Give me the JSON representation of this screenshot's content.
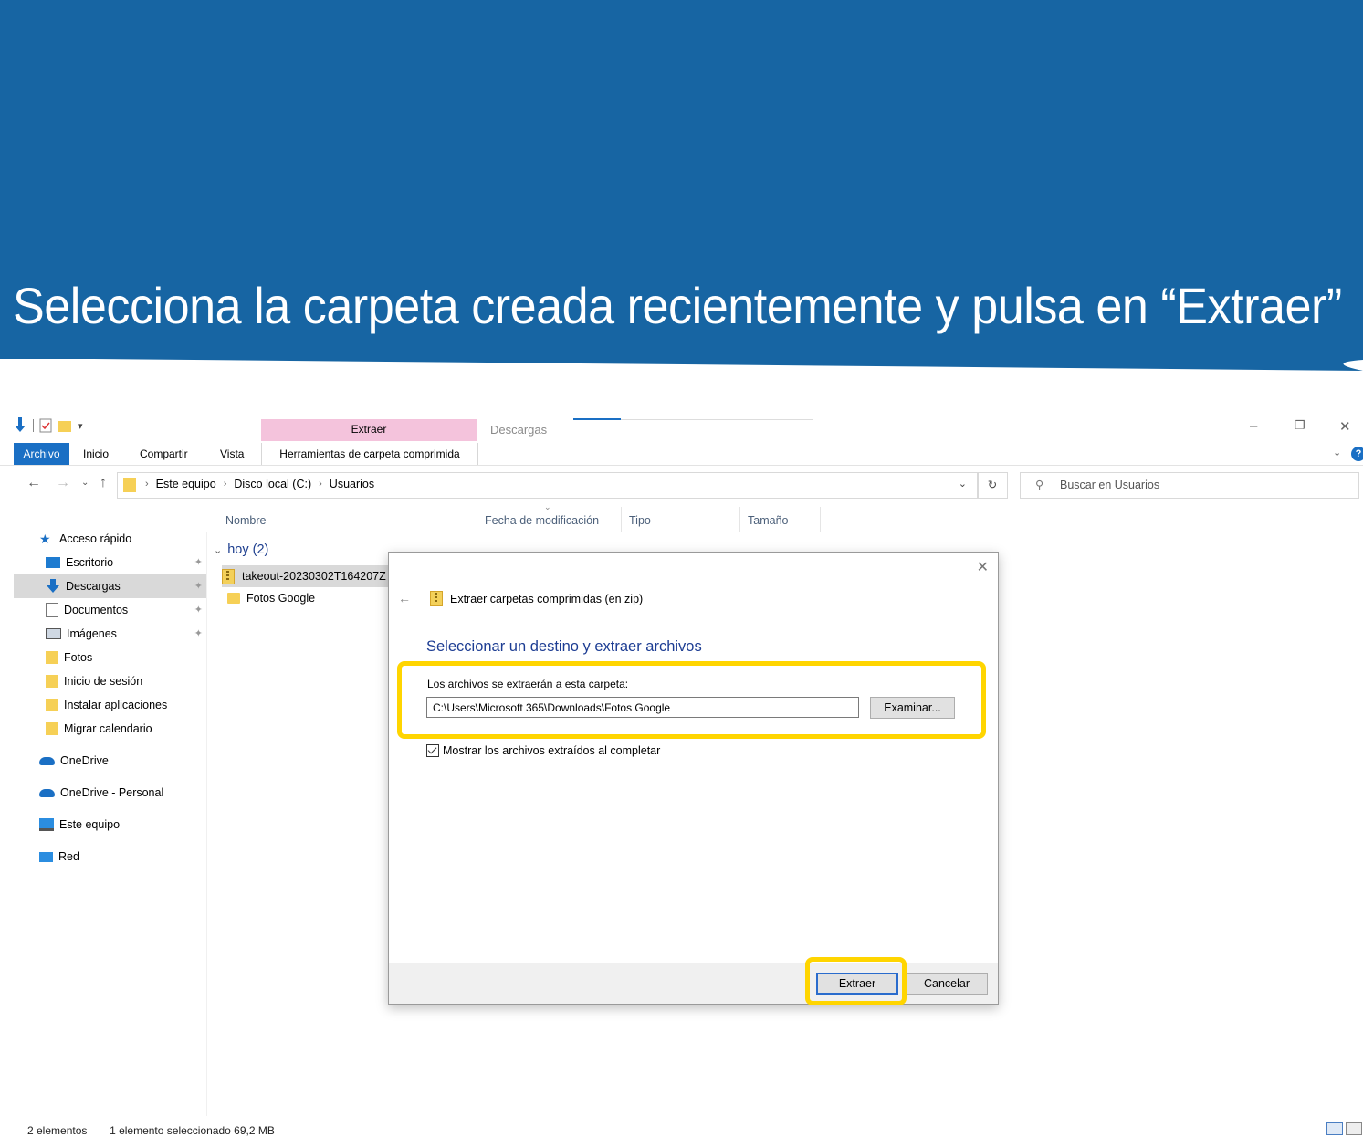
{
  "banner": {
    "title": "Selecciona la carpeta creada recientemente y pulsa en “Extraer”",
    "color": "#1765a3"
  },
  "window": {
    "title": "Descargas",
    "contextual_tab_group": "Extraer",
    "ribbon_tabs": [
      "Archivo",
      "Inicio",
      "Compartir",
      "Vista",
      "Herramientas de carpeta comprimida"
    ],
    "controls": {
      "minimize": "–",
      "restore": "❐",
      "close": "✕",
      "help": "?"
    }
  },
  "address": {
    "crumbs": [
      "Este equipo",
      "Disco local (C:)",
      "Usuarios"
    ],
    "search_placeholder": "Buscar en Usuarios"
  },
  "sidebar": {
    "items": [
      {
        "label": "Acceso rápido",
        "icon": "star-icon"
      },
      {
        "label": "Escritorio",
        "icon": "desktop-icon",
        "pinned": true
      },
      {
        "label": "Descargas",
        "icon": "download-icon",
        "pinned": true,
        "selected": true
      },
      {
        "label": "Documentos",
        "icon": "document-icon",
        "pinned": true
      },
      {
        "label": "Imágenes",
        "icon": "pictures-icon",
        "pinned": true
      },
      {
        "label": "Fotos",
        "icon": "folder-icon"
      },
      {
        "label": "Inicio de sesión",
        "icon": "folder-icon"
      },
      {
        "label": "Instalar aplicaciones",
        "icon": "folder-icon"
      },
      {
        "label": "Migrar calendario",
        "icon": "folder-icon"
      },
      {
        "label": "OneDrive",
        "icon": "cloud-icon"
      },
      {
        "label": "OneDrive - Personal",
        "icon": "cloud-icon"
      },
      {
        "label": "Este equipo",
        "icon": "computer-icon"
      },
      {
        "label": "Red",
        "icon": "network-icon"
      }
    ]
  },
  "file_list": {
    "columns": [
      "Nombre",
      "Fecha de modificación",
      "Tipo",
      "Tamaño"
    ],
    "group": "hoy (2)",
    "rows": [
      {
        "name": "takeout-20230302T164207Z",
        "icon": "zip-icon",
        "selected": true
      },
      {
        "name": "Fotos Google",
        "icon": "folder-icon"
      }
    ]
  },
  "status": {
    "count": "2 elementos",
    "selection": "1 elemento seleccionado  69,2 MB"
  },
  "dialog": {
    "header": "Extraer carpetas comprimidas (en zip)",
    "heading": "Seleccionar un destino y extraer archivos",
    "dest_label": "Los archivos se extraerán a esta carpeta:",
    "dest_value": "C:\\Users\\Microsoft 365\\Downloads\\Fotos Google",
    "browse": "Examinar...",
    "show_files": "Mostrar los archivos extraídos al completar",
    "show_files_checked": true,
    "extract": "Extraer",
    "cancel": "Cancelar"
  },
  "highlight_color": "#ffd500"
}
